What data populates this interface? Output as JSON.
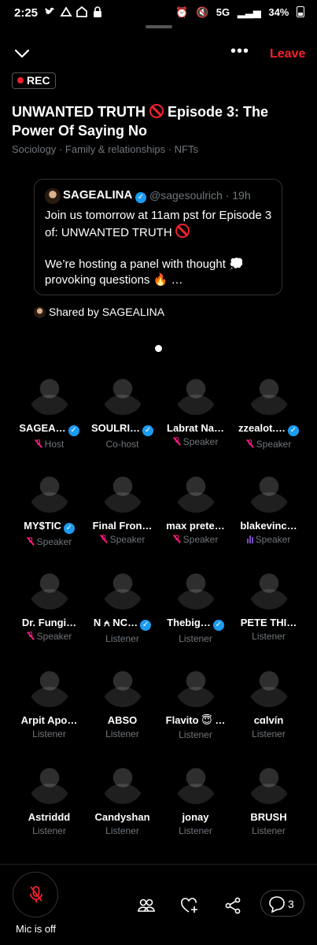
{
  "status_bar": {
    "time": "2:25",
    "network": "5G",
    "battery": "34%"
  },
  "topbar": {
    "more_label": "•••",
    "leave_label": "Leave"
  },
  "rec_label": "REC",
  "space": {
    "title_part1": "UNWANTED TRUTH",
    "title_part2": "Episode 3: The Power Of Saying No",
    "topics": "Sociology · Family & relationships · NFTs"
  },
  "tweet": {
    "author_name": "SAGEALINA",
    "handle": "@sagesoulrich · 19h",
    "text_line1": "Join us tomorrow at 11am pst for Episode 3 of: UNWANTED TRUTH",
    "text_line2_part1": "We’re hosting a panel with thought",
    "text_line2_part2": "provoking questions",
    "text_line2_part3": "…"
  },
  "shared_by": "Shared by SAGEALINA",
  "participants": [
    {
      "name": "SAGEA…",
      "role": "Host",
      "verified": true,
      "muted": true,
      "speaking": false,
      "color": "#3b2a22"
    },
    {
      "name": "SOULRI…",
      "role": "Co-host",
      "verified": true,
      "muted": false,
      "speaking": false,
      "color": "#000000"
    },
    {
      "name": "Labrat Na…",
      "role": "Speaker",
      "verified": false,
      "muted": true,
      "speaking": false,
      "color": "#4a2b2b"
    },
    {
      "name": "zzealot.…",
      "role": "Speaker",
      "verified": true,
      "muted": true,
      "speaking": false,
      "color": "#e8e8e8"
    },
    {
      "name": "MY$TIC",
      "role": "Speaker",
      "verified": true,
      "muted": true,
      "speaking": false,
      "color": "#000000"
    },
    {
      "name": "Final Fron…",
      "role": "Speaker",
      "verified": false,
      "muted": true,
      "speaking": false,
      "color": "#6a5ad4"
    },
    {
      "name": "max prete…",
      "role": "Speaker",
      "verified": false,
      "muted": true,
      "speaking": false,
      "color": "#6d8fb0"
    },
    {
      "name": "blakevinc…",
      "role": "Speaker",
      "verified": false,
      "muted": false,
      "speaking": true,
      "color": "#6d7a52"
    },
    {
      "name": "Dr. Fungi…",
      "role": "Speaker",
      "verified": false,
      "muted": true,
      "speaking": false,
      "color": "#c4a070"
    },
    {
      "name": "N ⍲ NC…",
      "role": "Listener",
      "verified": true,
      "muted": false,
      "speaking": false,
      "color": "#f2a9c4"
    },
    {
      "name": "Thebig…",
      "role": "Listener",
      "verified": true,
      "muted": false,
      "speaking": false,
      "color": "#3aa0c0"
    },
    {
      "name": "PETE THI…",
      "role": "Listener",
      "verified": false,
      "muted": false,
      "speaking": false,
      "color": "#cc2a3a"
    },
    {
      "name": "Arpit Apo…",
      "role": "Listener",
      "verified": false,
      "muted": false,
      "speaking": false,
      "color": "#c9302c"
    },
    {
      "name": "ABSO",
      "role": "Listener",
      "verified": false,
      "muted": false,
      "speaking": false,
      "color": "#1d3a44"
    },
    {
      "name": "Flavito 😇 …",
      "role": "Listener",
      "verified": false,
      "muted": false,
      "speaking": false,
      "color": "#1a0c06"
    },
    {
      "name": "cɑlvín",
      "role": "Listener",
      "verified": false,
      "muted": false,
      "speaking": false,
      "color": "#6aa0a8"
    },
    {
      "name": "Astriddd",
      "role": "Listener",
      "verified": false,
      "muted": false,
      "speaking": false,
      "color": "#7a5240"
    },
    {
      "name": "Candyshan",
      "role": "Listener",
      "verified": false,
      "muted": false,
      "speaking": false,
      "color": "#9c9c8a"
    },
    {
      "name": "jonay",
      "role": "Listener",
      "verified": false,
      "muted": false,
      "speaking": false,
      "color": "#3f5a64"
    },
    {
      "name": "BRUSH",
      "role": "Listener",
      "verified": false,
      "muted": false,
      "speaking": false,
      "color": "#111111"
    }
  ],
  "bottom_bar": {
    "mic_label": "Mic is off",
    "comments_count": "3"
  },
  "colors": {
    "accent_red": "#f4212e",
    "verified_blue": "#1d9bf0",
    "muted_pink": "#f91880",
    "speaking_purple": "#794bc4",
    "secondary_text": "#71767b"
  }
}
